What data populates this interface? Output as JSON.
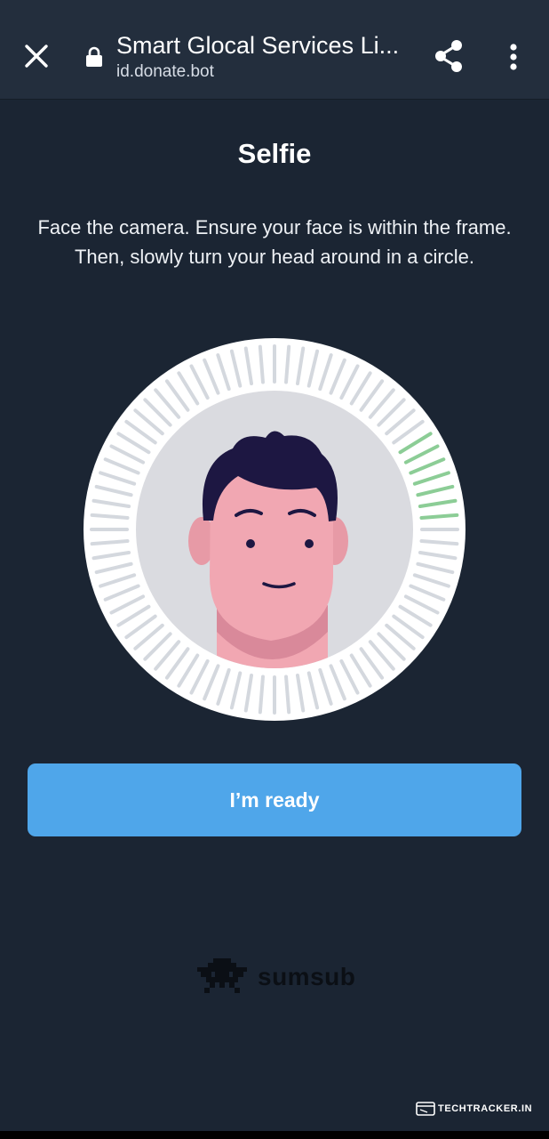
{
  "browser": {
    "title": "Smart Glocal Services Li...",
    "url": "id.donate.bot",
    "icons": [
      "close-icon",
      "lock-icon",
      "share-icon",
      "more-vertical-icon"
    ]
  },
  "page": {
    "heading": "Selfie",
    "instructions": "Face the camera. Ensure your face is within the frame. Then, slowly turn your head around in a circle.",
    "ready_button": "I’m ready"
  },
  "illustration": {
    "progress_highlight": "right-side segments green",
    "colors": {
      "background": "#1b2533",
      "topbar": "#232e3d",
      "button": "#4fa6ea",
      "tick_idle": "#d4d8de",
      "tick_done": "#8ccd96",
      "skin": "#f1a7b2",
      "hair": "#1d1742"
    }
  },
  "branding": {
    "name": "sumsub"
  },
  "watermark": {
    "text": "TECHTRACKER.IN"
  }
}
